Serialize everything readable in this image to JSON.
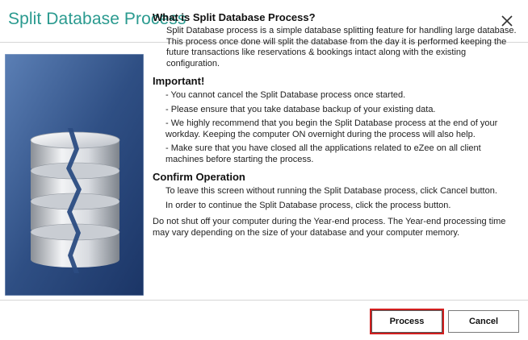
{
  "dialog": {
    "title": "Split Database Process"
  },
  "sections": {
    "what_heading": "What is Split Database Process?",
    "what_text": "Split Database process is a simple database splitting feature for handling large database. This process once done will split the database from the day it is performed keeping the future transactions like reservations & bookings intact along with the existing configuration.",
    "important_heading": "Important!",
    "important_items": [
      "- You cannot cancel the Split Database process once started.",
      "- Please ensure that you take database backup of your existing data.",
      "- We highly recommend that you begin the Split Database process at the end of your workday. Keeping the computer ON overnight during the process will also help.",
      "- Make sure that you have closed all the applications related to eZee on all client machines before starting the process."
    ],
    "confirm_heading": "Confirm Operation",
    "confirm_items": [
      "To leave this screen without running the Split Database process, click Cancel button.",
      "In order to continue the Split Database process, click the process button."
    ],
    "footer_text": "Do not shut off your computer during the Year-end process. The Year-end processing time may vary depending on the size of your database and your computer memory."
  },
  "buttons": {
    "process_label": "Process",
    "cancel_label": "Cancel"
  },
  "icons": {
    "close": "close-icon",
    "illustration": "split-database-icon"
  },
  "colors": {
    "title": "#2a9a8f",
    "highlight": "#d21f1f",
    "panel": "#3b5f92"
  }
}
